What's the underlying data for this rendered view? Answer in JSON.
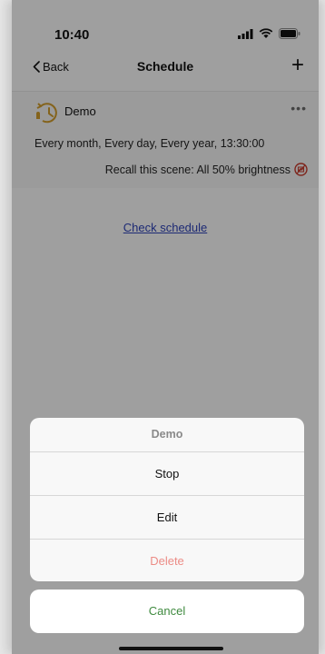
{
  "status_bar": {
    "time": "10:40"
  },
  "nav": {
    "back_label": "Back",
    "title": "Schedule",
    "add_label": "+"
  },
  "schedule_item": {
    "name": "Demo",
    "more": "•••",
    "frequency": "Every month, Every day, Every year, 13:30:00",
    "recall": "Recall this scene: All 50% brightness"
  },
  "check_link": "Check schedule",
  "action_sheet": {
    "title": "Demo",
    "items": [
      {
        "label": "Stop"
      },
      {
        "label": "Edit"
      },
      {
        "label": "Delete"
      }
    ],
    "cancel": "Cancel"
  },
  "colors": {
    "link": "#2b3fb0",
    "delete": "#ec8c86",
    "cancel": "#3f8a3f",
    "clock_icon": "#c9962b",
    "scene_icon": "#c0392b"
  }
}
